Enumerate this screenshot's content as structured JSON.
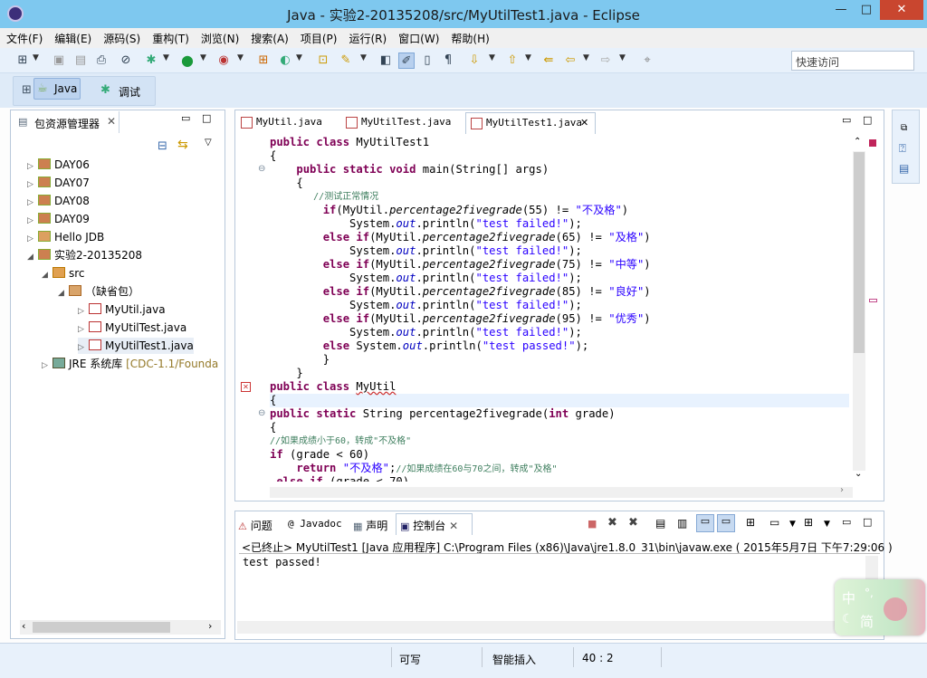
{
  "window": {
    "title": "Java  -  实验2-20135208/src/MyUtilTest1.java  -  Eclipse",
    "minimize": "—",
    "maximize": "□",
    "close": "✕"
  },
  "menu": [
    "文件(F)",
    "编辑(E)",
    "源码(S)",
    "重构(T)",
    "浏览(N)",
    "搜索(A)",
    "项目(P)",
    "运行(R)",
    "窗口(W)",
    "帮助(H)"
  ],
  "toolbar": {
    "quick_access_placeholder": "快速访问"
  },
  "perspectives": {
    "java": "Java",
    "debug": "调试"
  },
  "explorer": {
    "title": "包资源管理器",
    "items": [
      {
        "label": "DAY06"
      },
      {
        "label": "DAY07"
      },
      {
        "label": "DAY08"
      },
      {
        "label": "DAY09"
      },
      {
        "label": "Hello JDB"
      },
      {
        "label": "实验2-20135208"
      },
      {
        "label": "src"
      },
      {
        "label": "（缺省包）"
      },
      {
        "label": "MyUtil.java"
      },
      {
        "label": "MyUtilTest.java"
      },
      {
        "label": "MyUtilTest1.java"
      },
      {
        "label": "JRE 系统库",
        "suffix": "[CDC-1.1/Founda"
      }
    ]
  },
  "editor": {
    "tabs": [
      "MyUtil.java",
      "MyUtilTest.java",
      "MyUtilTest1.java"
    ],
    "code": [
      "public class MyUtilTest1",
      "{",
      "    public static void main(String[] args)",
      "    {",
      "        //测试正常情况",
      "        if(MyUtil.percentage2fivegrade(55) != \"不及格\")",
      "            System.out.println(\"test failed!\");",
      "        else if(MyUtil.percentage2fivegrade(65) != \"及格\")",
      "            System.out.println(\"test failed!\");",
      "        else if(MyUtil.percentage2fivegrade(75) != \"中等\")",
      "            System.out.println(\"test failed!\");",
      "        else if(MyUtil.percentage2fivegrade(85) != \"良好\")",
      "            System.out.println(\"test failed!\");",
      "        else if(MyUtil.percentage2fivegrade(95) != \"优秀\")",
      "            System.out.println(\"test failed!\");",
      "        else System.out.println(\"test passed!\");",
      "        }",
      "    }",
      "public class MyUtil",
      "{",
      "public static String percentage2fivegrade(int grade)",
      "{",
      "//如果成绩小于60，转成\"不及格\"",
      "if (grade < 60)",
      "    return \"不及格\";//如果成绩在60与70之间，转成\"及格\"",
      " else if (grade < 70)"
    ]
  },
  "console": {
    "tabs": [
      "问题",
      "@ Javadoc",
      "声明",
      "控制台"
    ],
    "header": "<已终止> MyUtilTest1 [Java 应用程序] C:\\Program Files (x86)\\Java\\jre1.8.0_31\\bin\\javaw.exe ( 2015年5月7日 下午7:29:06 )",
    "output": "test passed!"
  },
  "status": {
    "writable": "可写",
    "insert_mode": "智能插入",
    "position": "40 : 2"
  },
  "ime": {
    "lang": "中",
    "punct": "°,",
    "moon": "☾",
    "mode": "简"
  }
}
